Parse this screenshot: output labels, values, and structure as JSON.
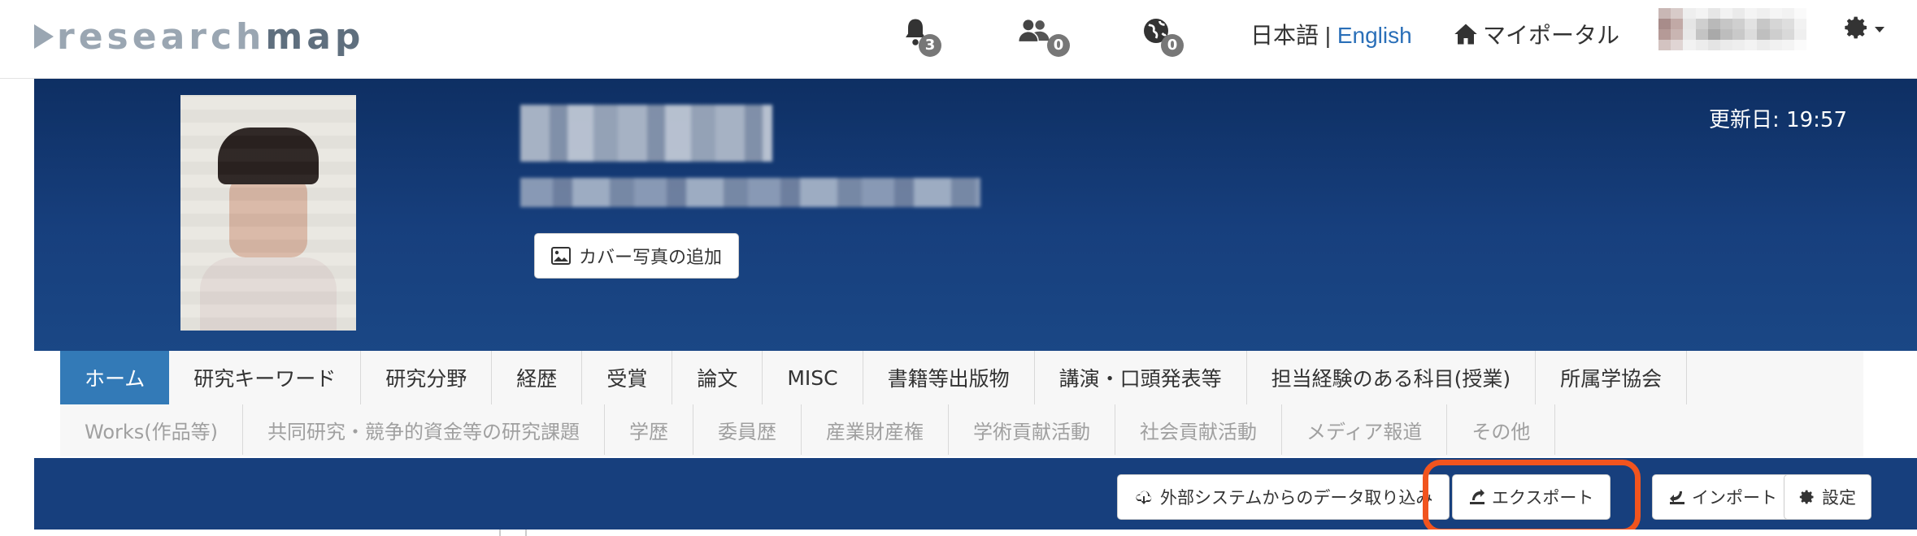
{
  "header": {
    "logo_light": "research",
    "logo_dark": "map",
    "notifications": [
      {
        "icon": "bell-icon",
        "count": "3"
      },
      {
        "icon": "users-icon",
        "count": "0"
      },
      {
        "icon": "globe-icon",
        "count": "0"
      }
    ],
    "lang_ja": "日本語",
    "lang_sep": "|",
    "lang_en": "English",
    "portal_label": "マイポータル"
  },
  "cover": {
    "add_cover_label": "カバー写真の追加",
    "updated_label": "更新日: 19:57"
  },
  "tabs": {
    "row1": [
      "ホーム",
      "研究キーワード",
      "研究分野",
      "経歴",
      "受賞",
      "論文",
      "MISC",
      "書籍等出版物",
      "講演・口頭発表等",
      "担当経験のある科目(授業)",
      "所属学協会"
    ],
    "row2": [
      "Works(作品等)",
      "共同研究・競争的資金等の研究課題",
      "学歴",
      "委員歴",
      "産業財産権",
      "学術貢献活動",
      "社会貢献活動",
      "メディア報道",
      "その他"
    ],
    "active_index": 0
  },
  "actions": {
    "external_import": "外部システムからのデータ取り込み",
    "export": "エクスポート",
    "import": "インポート",
    "settings": "設定"
  },
  "colors": {
    "accent": "#337ab7",
    "cover_dark": "#0e2f63",
    "cover_light": "#1a4785",
    "highlight": "#f1541e",
    "link": "#2a6fb8"
  }
}
